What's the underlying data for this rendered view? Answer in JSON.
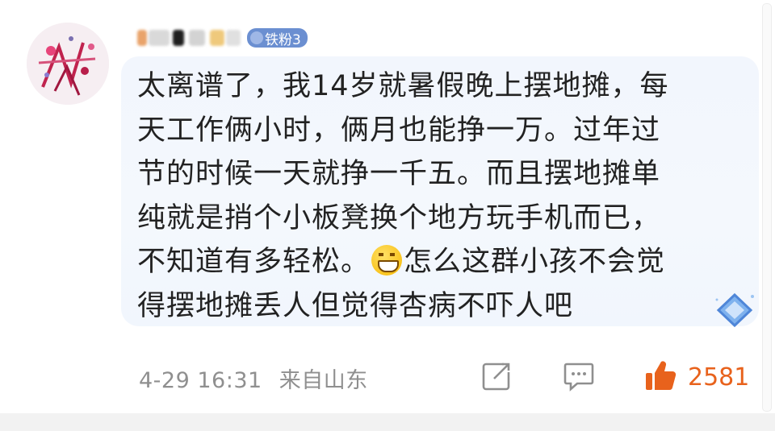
{
  "user": {
    "badge_label": "铁粉3"
  },
  "comment": {
    "lines": [
      "太离谱了，我14岁就暑假晚上摆地摊，每",
      "天工作俩小时，俩月也能挣一万。过年过",
      "节的时候一天就挣一千五。而且摆地摊单",
      "纯就是捎个小板凳换个地方玩手机而已，",
      "不知道有多轻松。",
      "怎么这群小孩不会觉",
      "得摆地摊丢人但觉得杏病不吓人吧"
    ]
  },
  "meta": {
    "timestamp": "4-29 16:31",
    "location": "来自山东"
  },
  "actions": {
    "like_count": "2581",
    "icons": [
      "share-icon",
      "comment-icon",
      "like-icon"
    ]
  },
  "colors": {
    "accent_like": "#e8621c",
    "badge_bg": "#6b8fd1",
    "bubble_bg": "#f2f6fd"
  }
}
